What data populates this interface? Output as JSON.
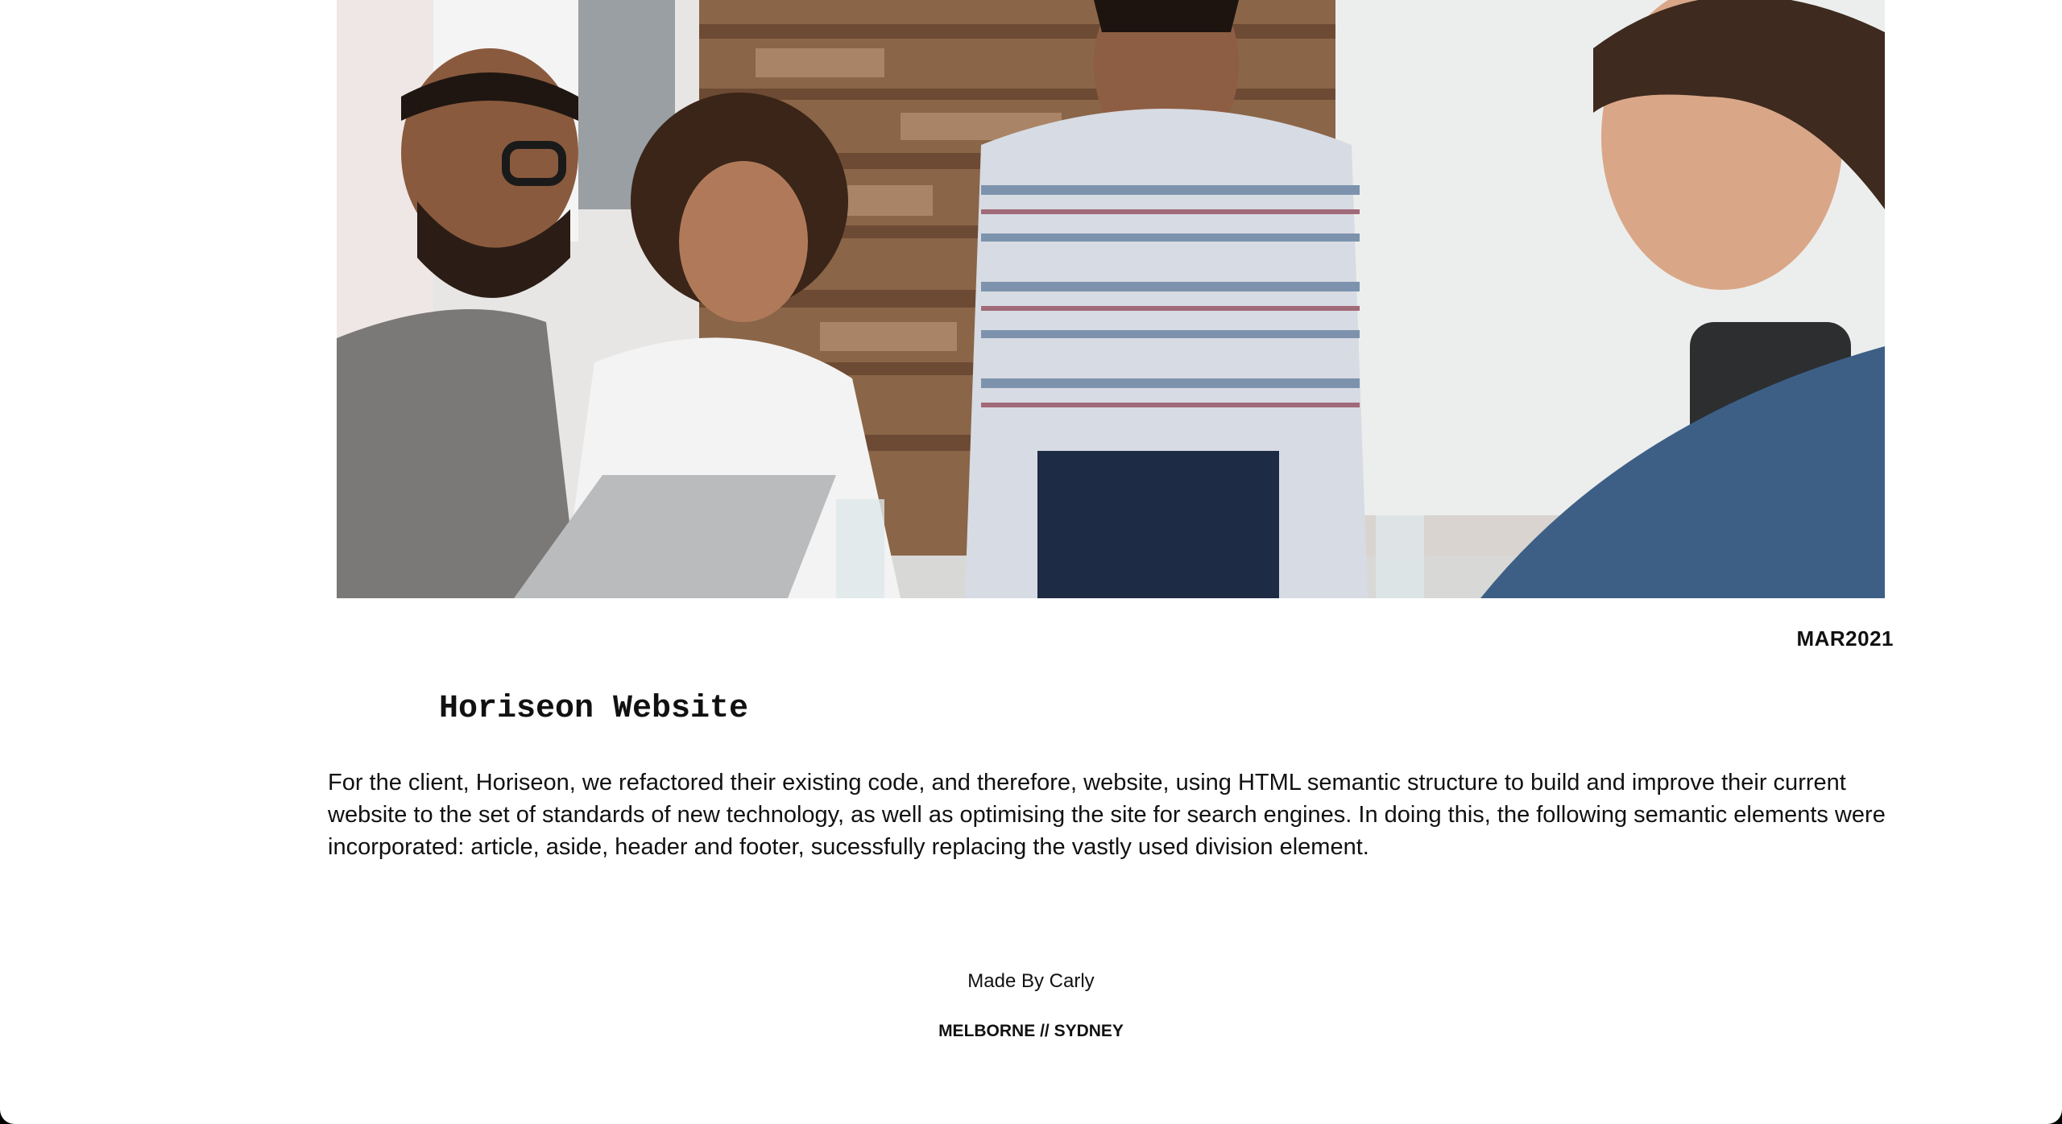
{
  "project": {
    "image_alt": "Team of four colleagues discussing around a laptop at a meeting table",
    "date": "MAR2021",
    "title": "Horiseon Website",
    "description": "For the client, Horiseon, we refactored their existing code, and therefore, website, using HTML semantic structure to build and improve their current website to the set of standards of new technology, as well as optimising the site for search engines. In doing this, the following semantic elements were incorporated: article, aside, header and footer, sucessfully replacing the vastly used division element."
  },
  "footer": {
    "made_by": "Made By Carly",
    "location": "MELBORNE // SYDNEY"
  }
}
